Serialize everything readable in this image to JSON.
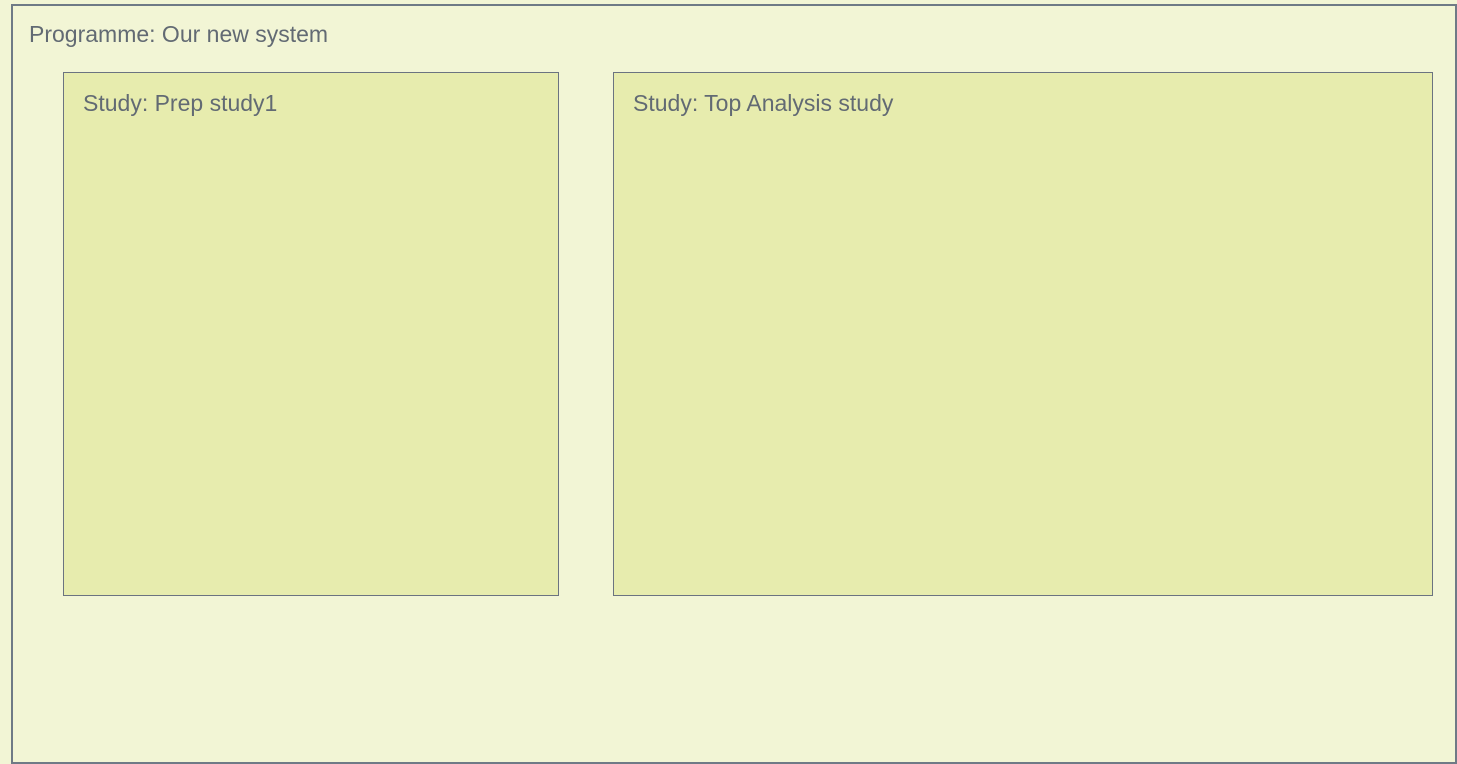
{
  "programme": {
    "label": "Programme: Our new system"
  },
  "studies": [
    {
      "label": "Study: Prep study1"
    },
    {
      "label": "Study: Top Analysis study"
    }
  ],
  "colors": {
    "page_background": "#f2f5d5",
    "study_fill": "#e7ecae",
    "border": "#6f7a86",
    "text": "#626a73"
  }
}
